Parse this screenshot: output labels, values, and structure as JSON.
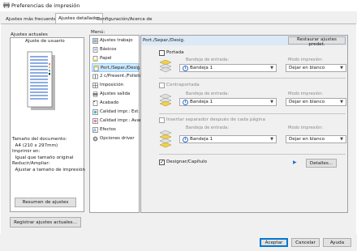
{
  "window": {
    "title": "Preferencias de impresión"
  },
  "tabs": [
    {
      "label": "Ajustes más frecuentes"
    },
    {
      "label": "Ajustes detallados"
    },
    {
      "label": "Configuración/Acerca de"
    }
  ],
  "left": {
    "current_settings_label": "Ajustes actuales",
    "user_setting_label": "Ajuste de usuario",
    "summary_lines": [
      "Tamaño del documento:",
      "  A4 (210 x 297mm)",
      "Imprimir en:",
      "  Igual que tamaño original",
      "Reducir/Ampliar:",
      "  Ajustar a tamaño de impresión"
    ],
    "summary_button": "Resumen de ajustes",
    "register_button": "Registrar ajustes actuales..."
  },
  "menu": {
    "label": "Menú:",
    "items": [
      {
        "label": "Ajustes trabajo",
        "icon": "job-settings-icon"
      },
      {
        "label": "Básicos",
        "icon": "basic-icon"
      },
      {
        "label": "Papel",
        "icon": "paper-icon"
      },
      {
        "label": "Port./Separ./Desig.",
        "icon": "cover-icon"
      },
      {
        "label": "2 c/Present./Folleto",
        "icon": "duplex-icon"
      },
      {
        "label": "Imposición",
        "icon": "imposition-icon"
      },
      {
        "label": "Ajustes salida",
        "icon": "output-icon"
      },
      {
        "label": "Acabado",
        "icon": "finishing-icon"
      },
      {
        "label": "Calidad impr.: Est.",
        "icon": "quality-icon"
      },
      {
        "label": "Calidad impr.: Avanz.",
        "icon": "quality-advanced-icon"
      },
      {
        "label": "Efectos",
        "icon": "effects-icon"
      },
      {
        "label": "Opciones driver",
        "icon": "driver-options-icon"
      }
    ],
    "selected_index": 3
  },
  "right": {
    "header": "Port./Separ./Desig.",
    "restore_button": "Restaurar ajustes predet.",
    "sections": [
      {
        "checkbox_label": "Portada",
        "checked": false,
        "enabled": true,
        "tray_label": "Bandeja de entrada:",
        "tray_value": "Bandeja 1",
        "mode_label": "Modo impresión:",
        "mode_value": "Dejar en blanco"
      },
      {
        "checkbox_label": "Contraportada",
        "checked": false,
        "enabled": false,
        "tray_label": "Bandeja de entrada:",
        "tray_value": "Bandeja 1",
        "mode_label": "Modo impresión:",
        "mode_value": "Dejar en blanco"
      },
      {
        "checkbox_label": "Insertar separador después de cada página",
        "checked": false,
        "enabled": false,
        "tray_label": "Bandeja de entrada:",
        "tray_value": "Bandeja 1",
        "mode_label": "Modo impresión:",
        "mode_value": "Dejar en blanco"
      }
    ],
    "designate_label": "Designar/Capítulo",
    "designate_checked": true,
    "details_button": "Detalles..."
  },
  "footer": {
    "ok": "Aceptar",
    "cancel": "Cancelar",
    "help": "Ayuda"
  }
}
